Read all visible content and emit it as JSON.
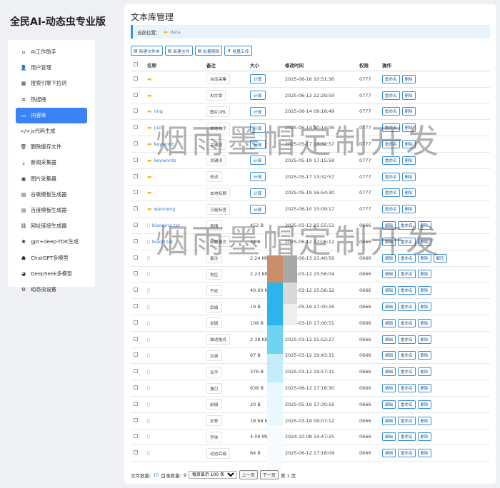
{
  "app": {
    "title": "全民AI-动态虫专业版"
  },
  "sidebar": {
    "items": [
      {
        "icon": "home-icon",
        "glyph": "⌂",
        "label": "AI工作助手",
        "active": false
      },
      {
        "icon": "user-icon",
        "glyph": "👤",
        "label": "用户管理",
        "active": false
      },
      {
        "icon": "table-icon",
        "glyph": "▦",
        "label": "搜索引擎下拉词",
        "active": false
      },
      {
        "icon": "paw-icon",
        "glyph": "✲",
        "label": "热搜榜",
        "active": false
      },
      {
        "icon": "folder-icon",
        "glyph": "▭",
        "label": "内容库",
        "active": true
      },
      {
        "icon": "code-icon",
        "glyph": "</>",
        "label": "js代码生成",
        "active": false
      },
      {
        "icon": "trash-icon",
        "glyph": "🗑",
        "label": "删除缓存文件",
        "active": false
      },
      {
        "icon": "download-icon",
        "glyph": "⤓",
        "label": "新闻采集器",
        "active": false
      },
      {
        "icon": "image-icon",
        "glyph": "▣",
        "label": "图片采集器",
        "active": false
      },
      {
        "icon": "template-icon",
        "glyph": "▤",
        "label": "谷歌模板生成器",
        "active": false
      },
      {
        "icon": "template-icon",
        "glyph": "▤",
        "label": "百度模板生成器",
        "active": false
      },
      {
        "icon": "link-icon",
        "glyph": "⛓",
        "label": "网址链接生成器",
        "active": false
      },
      {
        "icon": "brain-icon",
        "glyph": "✺",
        "label": "gpt+deep-TDK生成",
        "active": false
      },
      {
        "icon": "robot-icon",
        "glyph": "☗",
        "label": "ChatGPT多模型",
        "active": false
      },
      {
        "icon": "chat-icon",
        "glyph": "◕",
        "label": "DeepSeek多模型",
        "active": false
      },
      {
        "icon": "settings-icon",
        "glyph": "⚙",
        "label": "动态虫设置",
        "active": false
      }
    ]
  },
  "main": {
    "title": "文本库管理",
    "location_label": "当前位置：",
    "location_path": "data",
    "toolbar": [
      {
        "icon": "new-folder-icon",
        "glyph": "▤",
        "label": "新建文件夹"
      },
      {
        "icon": "new-file-icon",
        "glyph": "▤",
        "label": "新建文件"
      },
      {
        "icon": "batch-delete-icon",
        "glyph": "▤",
        "label": "批量删除"
      },
      {
        "icon": "upload-icon",
        "glyph": "⬆",
        "label": "批量上传"
      }
    ],
    "headers": {
      "name": "名称",
      "note": "备注",
      "size": "大小",
      "time": "修改时间",
      "perm": "权限",
      "action": "操作"
    },
    "rows": [
      {
        "type": "folder",
        "name": "",
        "note": "自动采集",
        "size": "计算",
        "time": "2025-06-16 10:51:36",
        "perm": "0777",
        "actions": [
          "重命名",
          "删除"
        ]
      },
      {
        "type": "folder",
        "name": "",
        "note": "AI文章",
        "size": "计算",
        "time": "2025-06-13 22:29:59",
        "perm": "0777",
        "actions": [
          "重命名",
          "删除"
        ]
      },
      {
        "type": "folder",
        "name": "img",
        "note": "图片URL",
        "size": "计算",
        "time": "2025-06-14 09:18:49",
        "perm": "0777",
        "actions": [
          "重命名",
          "删除"
        ]
      },
      {
        "type": "folder",
        "name": "juzi",
        "note": "本地句子",
        "size": "计算",
        "time": "2025-06-14 10:14:06",
        "perm": "0777",
        "actions": [
          "重命名",
          "删除"
        ]
      },
      {
        "type": "folder",
        "name": "keyword",
        "note": "关键词",
        "size": "计算",
        "time": "2025-05-17 13:32:57",
        "perm": "0777",
        "actions": [
          "重命名",
          "删除"
        ]
      },
      {
        "type": "folder",
        "name": "keywords",
        "note": "关键词",
        "size": "计算",
        "time": "2025-05-19 17:15:59",
        "perm": "0777",
        "actions": [
          "重命名",
          "删除"
        ]
      },
      {
        "type": "folder",
        "name": "",
        "note": "热词",
        "size": "计算",
        "time": "2025-05-17 13:32:57",
        "perm": "0777",
        "actions": [
          "重命名",
          "删除"
        ]
      },
      {
        "type": "folder",
        "name": "",
        "note": "本地标题",
        "size": "计算",
        "time": "2025-05-19 16:54:30",
        "perm": "0777",
        "actions": [
          "重命名",
          "删除"
        ]
      },
      {
        "type": "folder",
        "name": "wanneng",
        "note": "万能标签",
        "size": "计算",
        "time": "2025-06-10 15:09:17",
        "perm": "0777",
        "actions": [
          "重命名",
          "删除"
        ]
      },
      {
        "type": "file",
        "name": "biaoqing.txt",
        "note": "表情",
        "size": "452 B",
        "time": "2025-03-12 15:55:51",
        "perm": "0666",
        "actions": [
          "编辑",
          "重命名",
          "删除"
        ]
      },
      {
        "type": "file",
        "name": "biaoti.txt",
        "note": "标题模式",
        "size": "34 B",
        "time": "2025-06-12 17:06:12",
        "perm": "0666",
        "actions": [
          "编辑",
          "重命名",
          "删除"
        ]
      },
      {
        "type": "file",
        "name": "",
        "note": "备注",
        "size": "2.24 MB",
        "time": "2025-06-13 21:40:59",
        "perm": "0666",
        "actions": [
          "编辑",
          "重命名",
          "删除",
          "解压"
        ]
      },
      {
        "type": "file",
        "name": "",
        "note": "地区",
        "size": "2.23 KB",
        "time": "2025-03-12 15:56:04",
        "perm": "0666",
        "actions": [
          "编辑",
          "重命名",
          "删除"
        ]
      },
      {
        "type": "file",
        "name": "",
        "note": "干扰",
        "size": "40.60 KB",
        "time": "2025-03-12 15:56:32",
        "perm": "0666",
        "actions": [
          "编辑",
          "重命名",
          "删除"
        ]
      },
      {
        "type": "file",
        "name": "",
        "note": "后缀",
        "size": "19 B",
        "time": "2025-05-19 17:30:16",
        "perm": "0666",
        "actions": [
          "编辑",
          "重命名",
          "删除"
        ]
      },
      {
        "type": "file",
        "name": "",
        "note": "友链",
        "size": "108 B",
        "time": "2025-03-10 17:00:51",
        "perm": "0666",
        "actions": [
          "编辑",
          "重命名",
          "删除"
        ]
      },
      {
        "type": "file",
        "name": "",
        "note": "描述格式",
        "size": "2.38 KB",
        "time": "2025-03-12 15:52:27",
        "perm": "0666",
        "actions": [
          "编辑",
          "重命名",
          "删除"
        ]
      },
      {
        "type": "file",
        "name": "",
        "note": "目录",
        "size": "97 B",
        "time": "2025-03-12 19:43:31",
        "perm": "0666",
        "actions": [
          "编辑",
          "重命名",
          "删除"
        ]
      },
      {
        "type": "file",
        "name": "",
        "note": "名字",
        "size": "376 B",
        "time": "2025-03-12 19:57:31",
        "perm": "0666",
        "actions": [
          "编辑",
          "重命名",
          "删除"
        ]
      },
      {
        "type": "file",
        "name": "",
        "note": "搜引",
        "size": "638 B",
        "time": "2025-06-12 17:18:30",
        "perm": "0666",
        "actions": [
          "编辑",
          "重命名",
          "删除"
        ]
      },
      {
        "type": "file",
        "name": "",
        "note": "前缀",
        "size": "20 B",
        "time": "2025-05-19 17:30:16",
        "perm": "0666",
        "actions": [
          "编辑",
          "重命名",
          "删除"
        ]
      },
      {
        "type": "file",
        "name": "",
        "note": "全称",
        "size": "18.68 KB",
        "time": "2025-03-19 09:07:12",
        "perm": "0666",
        "actions": [
          "编辑",
          "重命名",
          "删除"
        ]
      },
      {
        "type": "file",
        "name": "",
        "note": "字体",
        "size": "4.09 MB",
        "time": "2024-10-08 14:47:25",
        "perm": "0666",
        "actions": [
          "编辑",
          "重命名",
          "删除"
        ]
      },
      {
        "type": "file",
        "name": "",
        "note": "动态后缀",
        "size": "64 B",
        "time": "2025-06-12 17:18:09",
        "perm": "0666",
        "actions": [
          "编辑",
          "重命名",
          "删除"
        ]
      }
    ],
    "footer": {
      "file_count_label": "文件数量:",
      "file_count": "15",
      "dir_count_label": "目录数量:",
      "dir_count": "9",
      "per_page": "每页显示 100 条",
      "prev": "上一页",
      "next": "下一页",
      "page_info": "第 1 页"
    }
  },
  "watermark": {
    "text": "烟雨墨帽定制开发"
  },
  "colors": {
    "accent": "#3b82f6",
    "folder": "#f5b82e",
    "link": "#3a7bd5"
  }
}
